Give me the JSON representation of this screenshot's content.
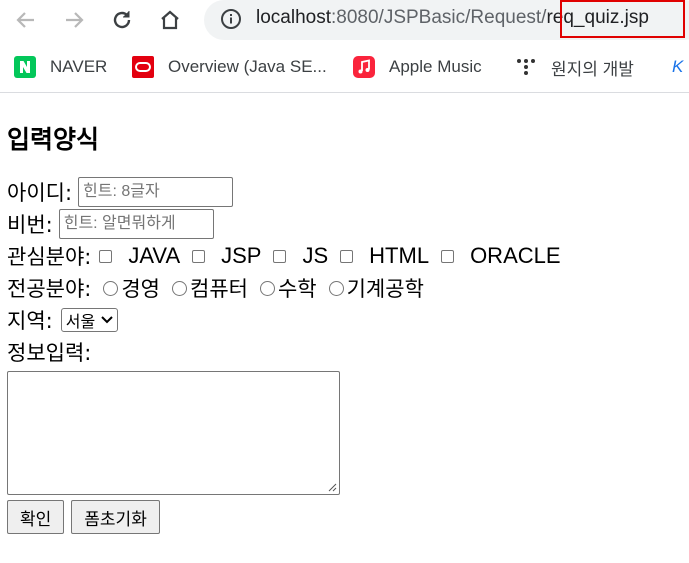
{
  "browser": {
    "url_host": "localhost",
    "url_path": ":8080/JSPBasic/Request/",
    "url_file": "req_quiz.jsp"
  },
  "bookmarks": [
    {
      "label": "NAVER"
    },
    {
      "label": "Overview (Java SE..."
    },
    {
      "label": "Apple Music"
    },
    {
      "label": "원지의 개발"
    },
    {
      "label": "K"
    }
  ],
  "form": {
    "heading": "입력양식",
    "id_label": "아이디:",
    "id_placeholder": "힌트: 8글자",
    "pw_label": "비번:",
    "pw_placeholder": "힌트: 알면뭐하게",
    "interest_label": "관심분야:",
    "interests": [
      "JAVA",
      "JSP",
      "JS",
      "HTML",
      "ORACLE"
    ],
    "major_label": "전공분야:",
    "majors": [
      "경영",
      "컴퓨터",
      "수학",
      "기계공학"
    ],
    "region_label": "지역:",
    "region_selected": "서울",
    "info_label": "정보입력:",
    "submit_label": "확인",
    "reset_label": "폼초기화"
  },
  "colors": {
    "highlight": "#e00000",
    "naver": "#03c75a",
    "oracle": "#e3000f",
    "apple_music": "#fa243c"
  }
}
